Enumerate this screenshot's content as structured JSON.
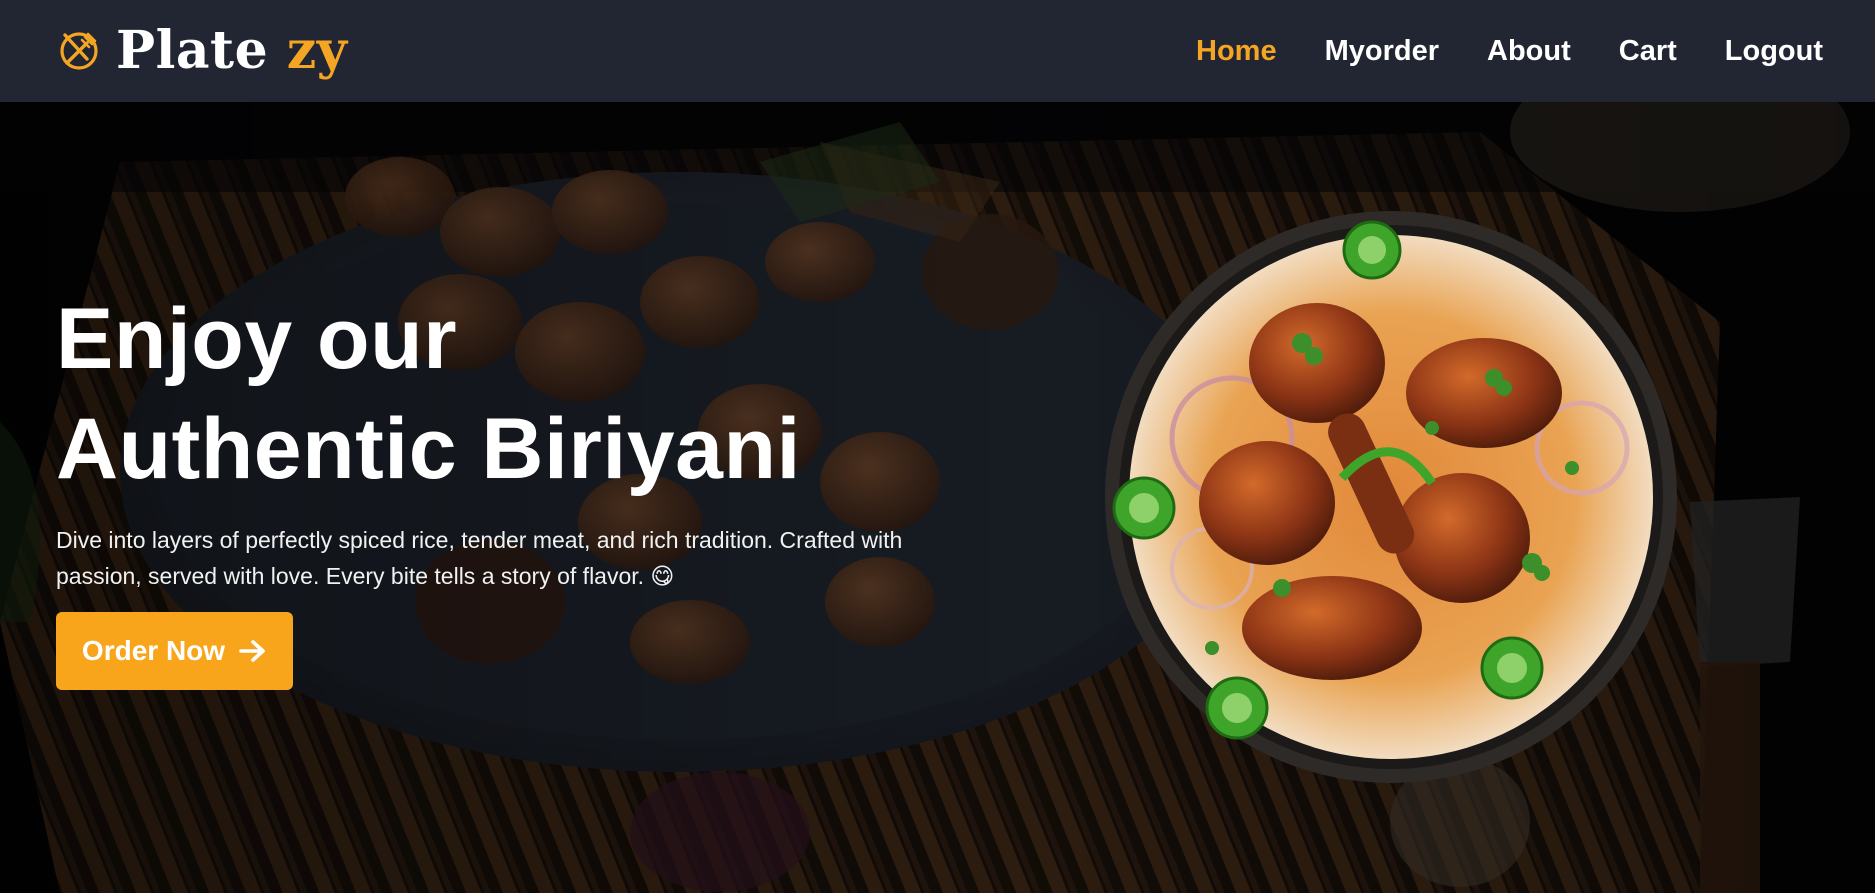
{
  "brand": {
    "name_main": "Plate",
    "name_accent": "zy",
    "logo_icon": "utensils-circle-icon"
  },
  "nav": {
    "items": [
      {
        "label": "Home",
        "active": true
      },
      {
        "label": "Myorder",
        "active": false
      },
      {
        "label": "About",
        "active": false
      },
      {
        "label": "Cart",
        "active": false
      },
      {
        "label": "Logout",
        "active": false
      }
    ]
  },
  "hero": {
    "title_line1": "Enjoy our",
    "title_line2": "Authentic Biriyani",
    "description": "Dive into layers of perfectly spiced rice, tender meat, and rich tradition. Crafted with passion, served with love. Every bite tells a story of flavor. 😋",
    "cta_label": "Order Now",
    "cta_icon": "arrow-right-icon",
    "image": "biriyani-bowl-image"
  },
  "colors": {
    "navbar_bg": "#222633",
    "accent": "#f5a524",
    "button_bg": "#f8a51c",
    "text": "#ffffff"
  }
}
